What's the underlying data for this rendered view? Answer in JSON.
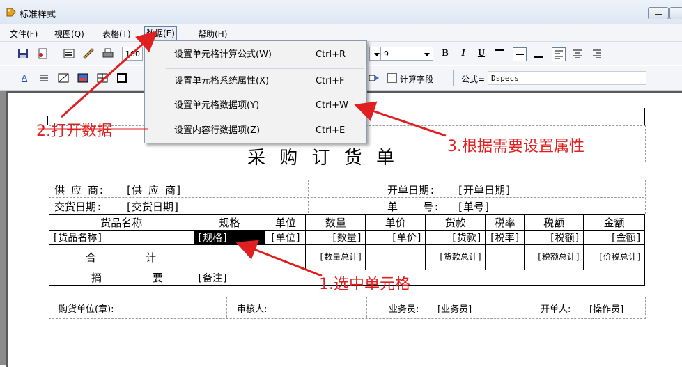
{
  "window": {
    "title": "标准样式"
  },
  "menubar": [
    "文件(F)",
    "视图(Q)",
    "表格(T)",
    "数据(E)",
    "帮助(H)"
  ],
  "toolbar": {
    "zoom": "100",
    "font_size": "9",
    "calc_field": "计算字段",
    "formula_label": "公式=",
    "formula_value": "Dspecs"
  },
  "dropdown": [
    {
      "label": "设置单元格计算公式(W)",
      "shortcut": "Ctrl+R"
    },
    {
      "label": "设置单元格系统属性(X)",
      "shortcut": "Ctrl+F"
    },
    {
      "label": "设置单元格数据项(Y)",
      "shortcut": "Ctrl+W"
    },
    {
      "label": "设置内容行数据项(Z)",
      "shortcut": "Ctrl+E"
    }
  ],
  "form": {
    "title": "采 购 订 货 单",
    "supplier_label": "供 应 商:",
    "supplier_value": "[供 应 商]",
    "delivery_label": "交货日期:",
    "delivery_value": "[交货日期]",
    "open_date_label": "开单日期:",
    "open_date_value": "[开单日期]",
    "order_no_label": "单    号:",
    "order_no_value": "[单号]",
    "headers": [
      "货品名称",
      "规格",
      "单位",
      "数量",
      "单价",
      "货款",
      "税率",
      "税额",
      "金额"
    ],
    "row": [
      "[货品名称]",
      "[规格]",
      "[单位]",
      "[数量]",
      "[单价]",
      "[货款]",
      "[税率]",
      "[税额]",
      "[金额]"
    ],
    "total_label_1": "合",
    "total_label_2": "计",
    "qty_total": "[数量总计]",
    "goods_total": "[货款总计]",
    "tax_total": "[税额总计]",
    "price_tax_total": "[价税总计]",
    "summary_label_1": "摘",
    "summary_label_2": "要",
    "remark": "[备注]",
    "footer": {
      "buyer_label": "购货单位(章):",
      "reviewer_label": "审核人:",
      "salesman_label": "业务员:",
      "salesman_value": "[业务员]",
      "issuer_label": "开单人:",
      "issuer_value": "[操作员]"
    }
  },
  "annotations": {
    "a1": "1.选中单元格",
    "a2": "2.打开数据",
    "a3": "3.根据需要设置属性"
  },
  "colors": {
    "annotation": "#e02020",
    "selection": "#000000"
  }
}
